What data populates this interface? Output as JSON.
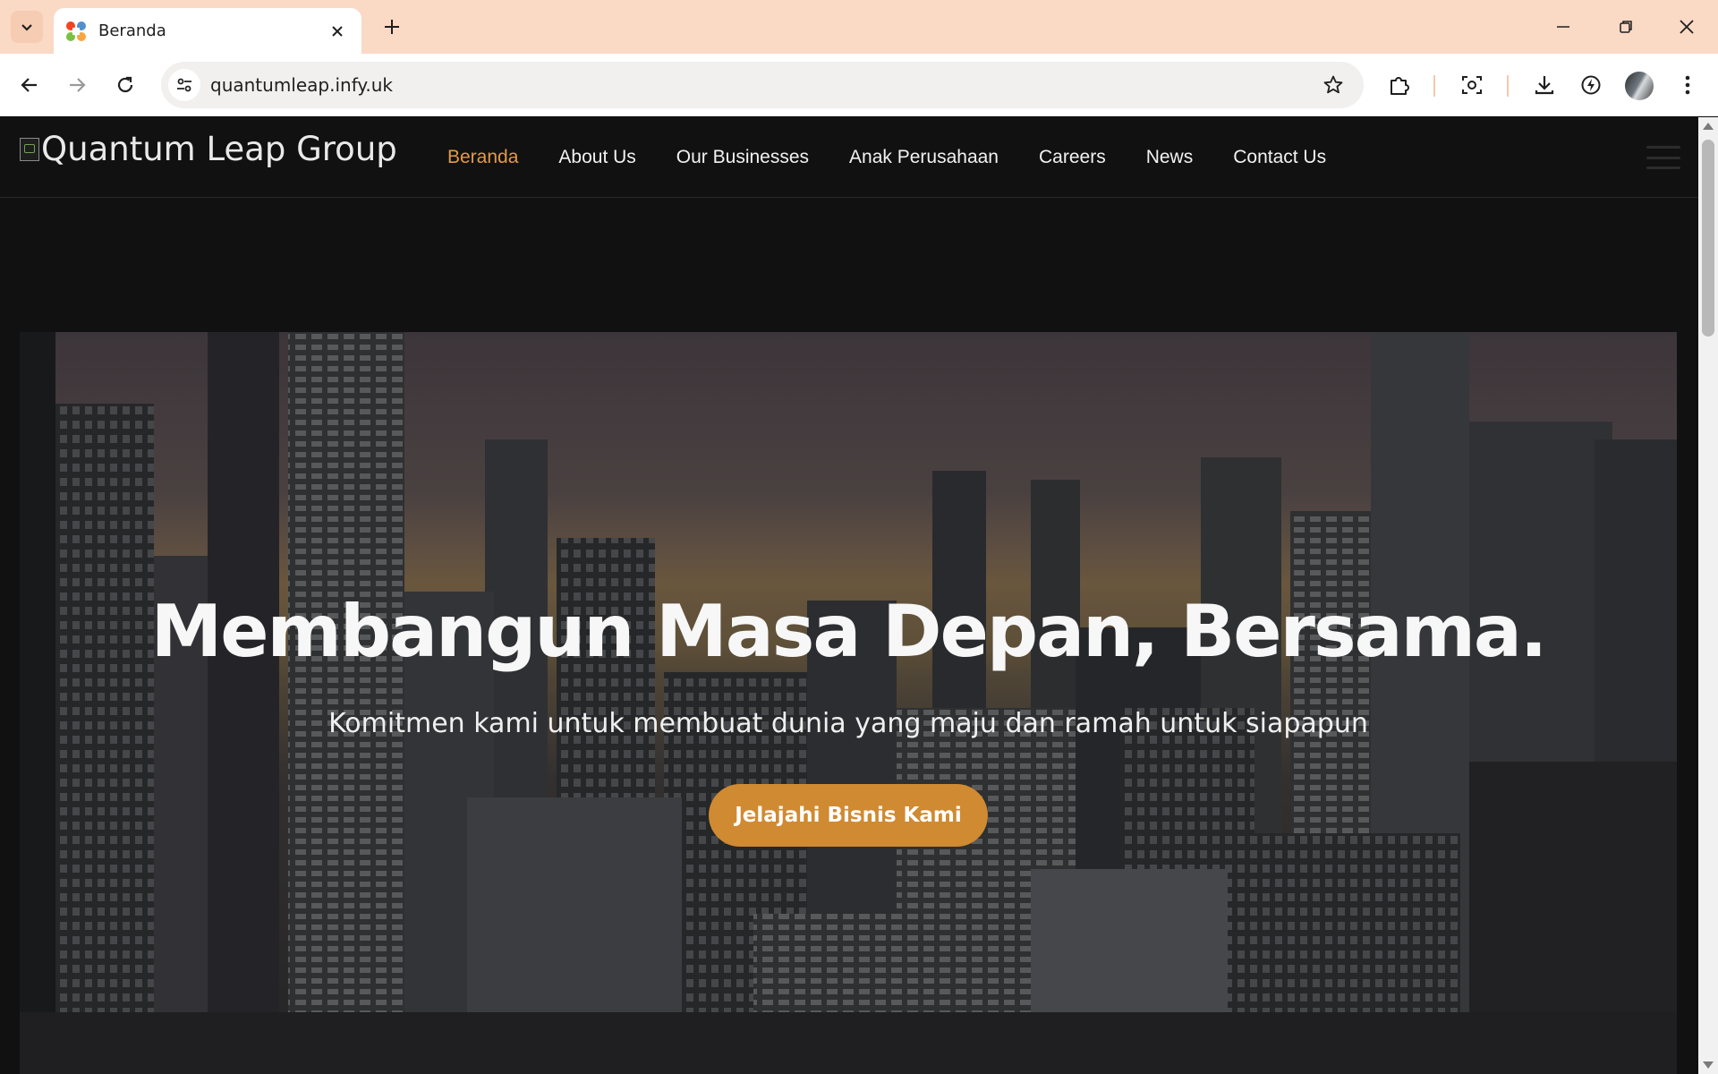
{
  "browser": {
    "tab_title": "Beranda",
    "url": "quantumleap.infy.uk",
    "icons": {
      "tab_search": "chevron-down-icon",
      "favicon": "joomla-favicon-icon",
      "tab_close": "close-icon",
      "new_tab": "plus-icon",
      "minimize": "minimize-icon",
      "restore": "restore-icon",
      "close_window": "close-icon",
      "back": "arrow-left-icon",
      "forward": "arrow-right-icon",
      "reload": "reload-icon",
      "site_info": "tune-icon",
      "bookmark": "star-icon",
      "extensions": "puzzle-icon",
      "screenshot": "camera-search-icon",
      "downloads": "download-icon",
      "performance": "lightning-icon",
      "profile": "avatar",
      "menu": "more-vert-icon"
    },
    "tabstrip_color": "#fad9c5"
  },
  "site": {
    "logo_text": "Quantum Leap Group",
    "nav": [
      {
        "label": "Beranda",
        "active": true
      },
      {
        "label": "About Us",
        "active": false
      },
      {
        "label": "Our Businesses",
        "active": false
      },
      {
        "label": "Anak Perusahaan",
        "active": false
      },
      {
        "label": "Careers",
        "active": false
      },
      {
        "label": "News",
        "active": false
      },
      {
        "label": "Contact Us",
        "active": false
      }
    ],
    "accent_color": "#e39a45"
  },
  "hero": {
    "title": "Membangun Masa Depan, Bersama.",
    "subtitle": "Komitmen kami untuk membuat dunia yang maju dan ramah untuk siapapun",
    "cta_label": "Jelajahi Bisnis Kami",
    "cta_color": "#d08a31"
  }
}
